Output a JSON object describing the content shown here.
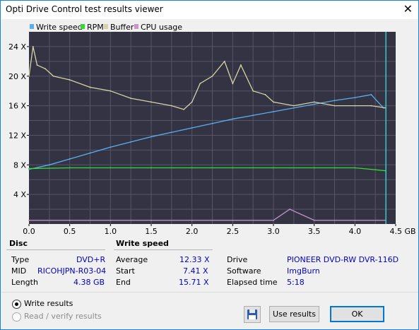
{
  "window": {
    "title": "Opti Drive Control test results viewer",
    "close_glyph": "✕"
  },
  "legend": [
    {
      "label": "Write speed",
      "color": "#5aaff0"
    },
    {
      "label": "RPM",
      "color": "#32dc32"
    },
    {
      "label": "Buffer",
      "color": "#d7d2a5"
    },
    {
      "label": "CPU usage",
      "color": "#c896c8"
    }
  ],
  "chart_data": {
    "type": "line",
    "x_unit": "GB",
    "xlim": [
      0,
      4.5
    ],
    "ylim": [
      0,
      26
    ],
    "x_ticks": [
      "0.0",
      "0.5",
      "1.0",
      "1.5",
      "2.0",
      "2.5",
      "3.0",
      "3.5",
      "4.0",
      "4.5 GB"
    ],
    "y_ticks": [
      "4 X",
      "8 X",
      "12 X",
      "16 X",
      "20 X",
      "24 X"
    ],
    "grid": true,
    "background": "#333344",
    "series": [
      {
        "name": "Write speed",
        "color": "#5aaff0",
        "x": [
          0.0,
          0.25,
          0.5,
          0.75,
          1.0,
          1.25,
          1.5,
          1.75,
          2.0,
          2.25,
          2.5,
          2.75,
          3.0,
          3.25,
          3.5,
          3.75,
          4.0,
          4.2,
          4.35,
          4.38
        ],
        "y": [
          7.4,
          8.0,
          8.8,
          9.6,
          10.4,
          11.1,
          11.8,
          12.4,
          13.0,
          13.6,
          14.2,
          14.7,
          15.2,
          15.7,
          16.2,
          16.7,
          17.1,
          17.5,
          15.7,
          15.7
        ]
      },
      {
        "name": "RPM",
        "color": "#32dc32",
        "x": [
          0.0,
          0.5,
          1.0,
          1.5,
          2.0,
          2.5,
          3.0,
          3.5,
          4.0,
          4.38
        ],
        "y": [
          7.5,
          7.6,
          7.6,
          7.6,
          7.6,
          7.6,
          7.6,
          7.6,
          7.6,
          7.2
        ]
      },
      {
        "name": "Buffer",
        "color": "#d7d2a5",
        "x": [
          0.0,
          0.05,
          0.1,
          0.2,
          0.3,
          0.5,
          0.75,
          1.0,
          1.25,
          1.5,
          1.75,
          1.9,
          2.0,
          2.1,
          2.25,
          2.4,
          2.5,
          2.6,
          2.75,
          2.9,
          3.0,
          3.25,
          3.5,
          3.75,
          4.0,
          4.2,
          4.38
        ],
        "y": [
          20.0,
          24.0,
          21.5,
          21.0,
          20.0,
          19.5,
          18.5,
          18.0,
          17.0,
          16.5,
          16.0,
          15.5,
          16.5,
          19.0,
          20.0,
          22.0,
          19.0,
          21.5,
          18.0,
          17.5,
          16.5,
          16.0,
          16.5,
          16.0,
          16.0,
          16.0,
          15.7
        ]
      },
      {
        "name": "CPU usage",
        "color": "#c896c8",
        "x": [
          0.0,
          0.5,
          1.0,
          1.5,
          2.0,
          2.5,
          3.0,
          3.2,
          3.5,
          4.0,
          4.38
        ],
        "y": [
          0.5,
          0.5,
          0.5,
          0.5,
          0.5,
          0.5,
          0.5,
          2.0,
          0.5,
          0.5,
          0.5
        ]
      }
    ]
  },
  "disc": {
    "header": "Disc",
    "rows": [
      {
        "label": "Type",
        "value": "DVD+R"
      },
      {
        "label": "MID",
        "value": "RICOHJPN-R03-04"
      },
      {
        "label": "Length",
        "value": "4.38 GB"
      }
    ]
  },
  "write_speed": {
    "header": "Write speed",
    "rows": [
      {
        "label": "Average",
        "value": "12.33 X"
      },
      {
        "label": "Start",
        "value": "7.41 X"
      },
      {
        "label": "End",
        "value": "15.71 X"
      }
    ]
  },
  "drive_info": {
    "rows": [
      {
        "label": "Drive",
        "value": "PIONEER  DVD-RW  DVR-116D"
      },
      {
        "label": "Software",
        "value": "ImgBurn"
      },
      {
        "label": "Elapsed time",
        "value": "5:18"
      }
    ]
  },
  "options": {
    "write_results": "Write results",
    "read_verify_results": "Read / verify results"
  },
  "buttons": {
    "use_results": "Use results",
    "ok": "OK"
  },
  "icons": {
    "save": "floppy-disk-icon",
    "close": "close-icon"
  }
}
